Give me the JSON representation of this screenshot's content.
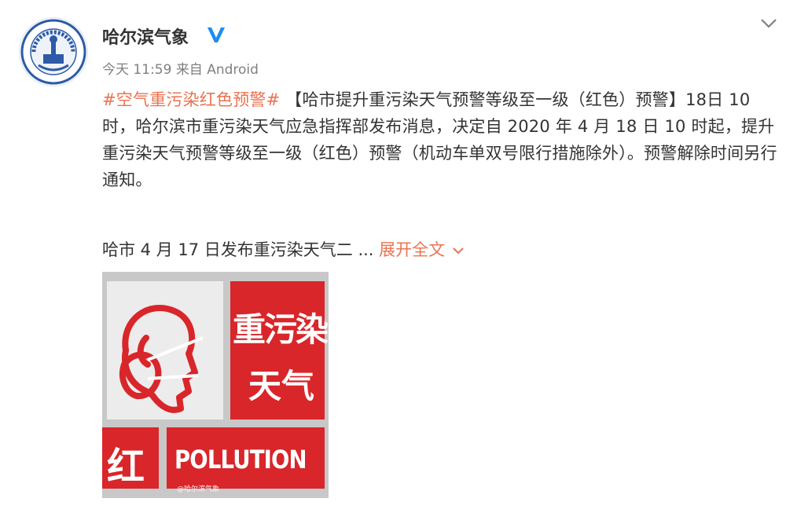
{
  "post": {
    "author": "哈尔滨气象",
    "time": "今天 11:59",
    "source": "来自 Android",
    "hashtag": "#空气重污染红色预警#",
    "body": " 【哈市提升重污染天气预警等级至一级（红色）预警】18日 10 时，哈尔滨市重污染天气应急指挥部发布消息，决定自 2020 年 4 月 18 日 10 时起，提升重污染天气预警等级至一级（红色）预警（机动车单双号限行措施除外）。预警解除时间另行通知。",
    "snippet": "哈市 4 月 17 日发布重污染天气二 ... ",
    "expand_label": "展开全文"
  },
  "poster": {
    "line1": "重污染",
    "line2": "天气",
    "level": "红",
    "english": "POLLUTION",
    "watermark": "@哈尔滨气象"
  },
  "colors": {
    "link": "#eb7350",
    "verified": "#1d8cf0",
    "poster_red": "#d8262a",
    "poster_gray": "#c8c8c8"
  },
  "icons": {
    "avatar": "meteorological-bureau-logo",
    "verified": "verified-v-icon",
    "menu": "chevron-down-icon",
    "expand": "chevron-down-icon",
    "mask": "face-mask-icon"
  }
}
